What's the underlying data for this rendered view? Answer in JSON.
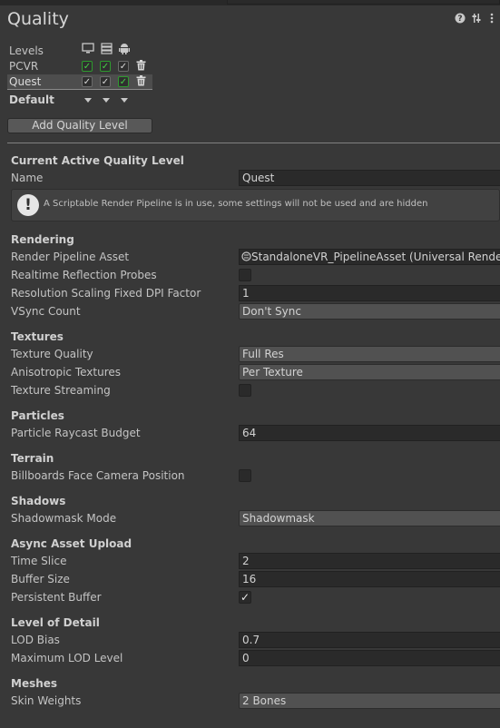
{
  "header": {
    "title": "Quality",
    "help_icon": "help-icon",
    "settings_icon": "presets-icon",
    "menu_icon": "more-icon"
  },
  "levels": {
    "label": "Levels",
    "platform_icons": [
      "monitor-icon",
      "server-icon",
      "android-icon"
    ],
    "rows": [
      {
        "name": "PCVR",
        "checks": [
          "green",
          "green",
          "grey"
        ]
      },
      {
        "name": "Quest",
        "checks": [
          "grey",
          "grey",
          "green"
        ],
        "selected": true
      }
    ],
    "default_label": "Default"
  },
  "add_button": "Add Quality Level",
  "current": {
    "heading": "Current Active Quality Level",
    "name_label": "Name",
    "name_value": "Quest",
    "info_text": "A Scriptable Render Pipeline is in use, some settings will not be used and are hidden"
  },
  "rendering": {
    "heading": "Rendering",
    "pipeline_label": "Render Pipeline Asset",
    "pipeline_value": "StandaloneVR_PipelineAsset (Universal Render P",
    "reflection_label": "Realtime Reflection Probes",
    "reflection_checked": false,
    "dpi_label": "Resolution Scaling Fixed DPI Factor",
    "dpi_value": "1",
    "vsync_label": "VSync Count",
    "vsync_value": "Don't Sync"
  },
  "textures": {
    "heading": "Textures",
    "quality_label": "Texture Quality",
    "quality_value": "Full Res",
    "aniso_label": "Anisotropic Textures",
    "aniso_value": "Per Texture",
    "streaming_label": "Texture Streaming",
    "streaming_checked": false
  },
  "particles": {
    "heading": "Particles",
    "budget_label": "Particle Raycast Budget",
    "budget_value": "64"
  },
  "terrain": {
    "heading": "Terrain",
    "billboard_label": "Billboards Face Camera Position",
    "billboard_checked": false
  },
  "shadows": {
    "heading": "Shadows",
    "mask_label": "Shadowmask Mode",
    "mask_value": "Shadowmask"
  },
  "async_upload": {
    "heading": "Async Asset Upload",
    "time_label": "Time Slice",
    "time_value": "2",
    "buffer_label": "Buffer Size",
    "buffer_value": "16",
    "persistent_label": "Persistent Buffer",
    "persistent_checked": true
  },
  "lod": {
    "heading": "Level of Detail",
    "bias_label": "LOD Bias",
    "bias_value": "0.7",
    "max_label": "Maximum LOD Level",
    "max_value": "0"
  },
  "meshes": {
    "heading": "Meshes",
    "skin_label": "Skin Weights",
    "skin_value": "2 Bones"
  },
  "check_glyph": "✓"
}
